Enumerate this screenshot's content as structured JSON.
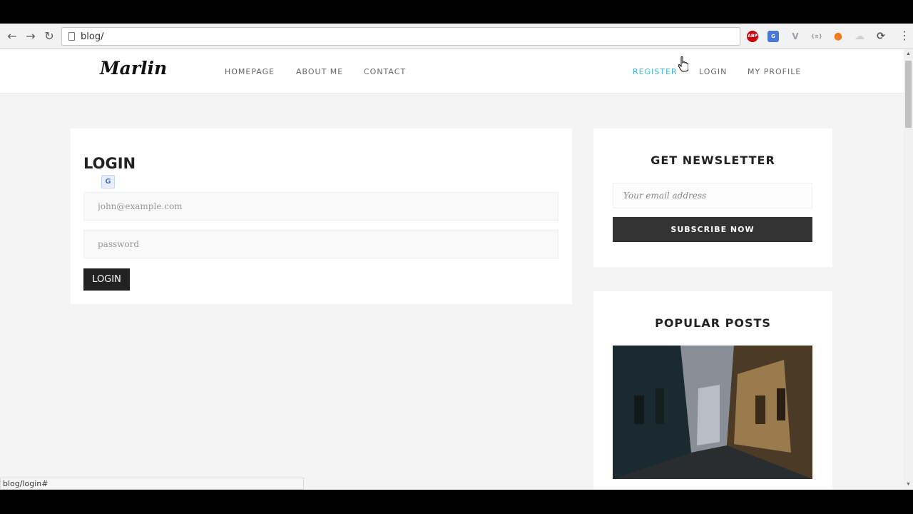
{
  "browser": {
    "url": "blog/",
    "status_url": "blog/login#",
    "extensions": [
      {
        "name": "adblock-plus-icon",
        "label": "ABP",
        "color": "#c7000b"
      },
      {
        "name": "google-translate-icon",
        "label": "G",
        "color": "#4a78d6"
      },
      {
        "name": "vue-devtools-icon",
        "label": "V",
        "color": "#9aa0a6"
      },
      {
        "name": "json-viewer-icon",
        "label": "{≡}",
        "color": "#b0b0b0"
      },
      {
        "name": "orange-extension-icon",
        "label": "●",
        "color": "#f07a1c"
      },
      {
        "name": "cloud-extension-icon",
        "label": "☁",
        "color": "#d8d8d8"
      },
      {
        "name": "sync-extension-icon",
        "label": "⟳",
        "color": "#555555"
      }
    ]
  },
  "site": {
    "logo": "Marlin",
    "nav_left": [
      "HOMEPAGE",
      "ABOUT ME",
      "CONTACT"
    ],
    "nav_right": [
      "REGISTER",
      "LOGIN",
      "MY PROFILE"
    ],
    "accent_color": "#3bb4cf"
  },
  "login": {
    "title": "LOGIN",
    "email_placeholder": "john@example.com",
    "password_placeholder": "password",
    "button_label": "LOGIN"
  },
  "newsletter": {
    "title": "GET NEWSLETTER",
    "email_placeholder": "Your email address",
    "button_label": "SUBSCRIBE NOW"
  },
  "popular_posts": {
    "title": "POPULAR POSTS"
  }
}
